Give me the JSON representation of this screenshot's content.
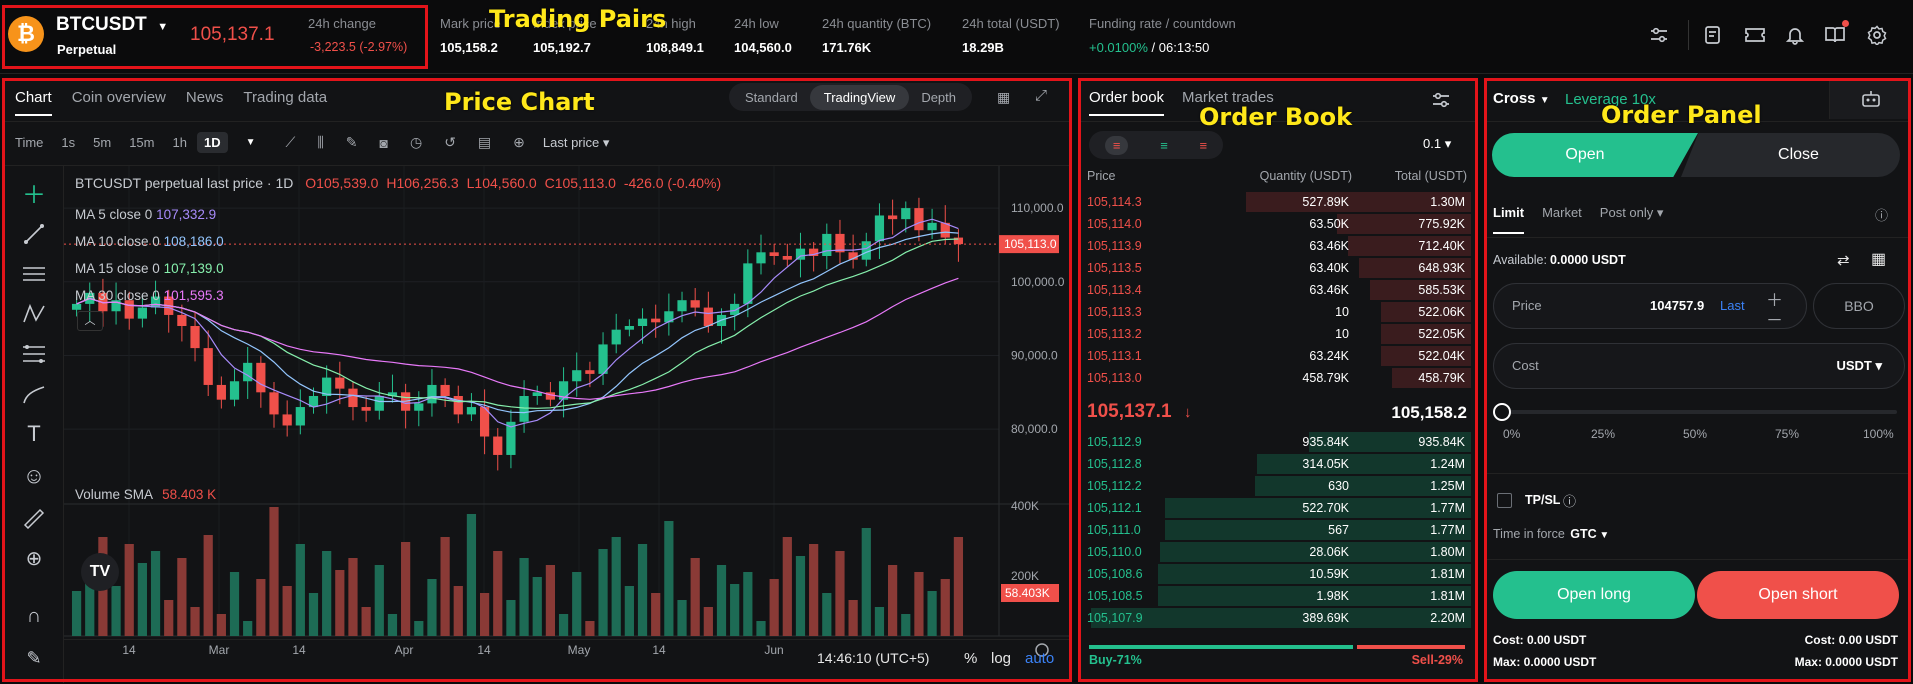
{
  "annotations": {
    "pairs": "Trading Pairs",
    "chart": "Price Chart",
    "orderbook": "Order Book",
    "orderpanel": "Order Panel"
  },
  "ticker": {
    "symbol": "BTCUSDT",
    "type": "Perpetual",
    "last": "105,137.1",
    "change_label": "24h change",
    "change_value": "-3,223.5 (-2.97%)",
    "stats": [
      {
        "label": "Mark price",
        "value": "105,158.2"
      },
      {
        "label": "Index price",
        "value": "105,192.7"
      },
      {
        "label": "24h high",
        "value": "108,849.1"
      },
      {
        "label": "24h low",
        "value": "104,560.0"
      },
      {
        "label": "24h quantity (BTC)",
        "value": "171.76K"
      },
      {
        "label": "24h total (USDT)",
        "value": "18.29B"
      }
    ],
    "funding_label": "Funding rate / countdown",
    "funding_rate": "+0.0100%",
    "countdown": "/ 06:13:50"
  },
  "chart": {
    "tabs": [
      "Chart",
      "Coin overview",
      "News",
      "Trading data"
    ],
    "views": [
      "Standard",
      "TradingView",
      "Depth"
    ],
    "intervals": [
      "Time",
      "1s",
      "5m",
      "15m",
      "1h",
      "1D"
    ],
    "price_type": "Last price",
    "legend_title": "BTCUSDT perpetual last price · 1D",
    "ohlc": {
      "o": "O105,539.0",
      "h": "H106,256.3",
      "l": "L104,560.0",
      "c": "C105,113.0",
      "chg": "-426.0 (-0.40%)"
    },
    "ma": [
      {
        "label": "MA 5 close 0",
        "value": "107,332.9",
        "color": "#a78bfa"
      },
      {
        "label": "MA 10 close 0",
        "value": "108,186.0",
        "color": "#93c5fd"
      },
      {
        "label": "MA 15 close 0",
        "value": "107,139.0",
        "color": "#86efac"
      },
      {
        "label": "MA 30 close 0",
        "value": "101,595.3",
        "color": "#e879f9"
      }
    ],
    "volume_label": "Volume SMA",
    "volume_value": "58.403 K",
    "price_ticks": [
      "110,000.0",
      "100,000.0",
      "90,000.0",
      "80,000.0"
    ],
    "vol_ticks": [
      "400K",
      "200K"
    ],
    "current_price_tag": "105,113.0",
    "vol_tag": "58.403K",
    "x_ticks": [
      "14",
      "Mar",
      "14",
      "Apr",
      "14",
      "May",
      "14",
      "Jun"
    ],
    "clock": "14:46:10 (UTC+5)",
    "pct": "%",
    "log": "log",
    "auto": "auto",
    "tv_logo": "TV"
  },
  "chart_data": {
    "type": "candlestick",
    "x_range": [
      "2025-02-06",
      "2025-05-31"
    ],
    "ylim": [
      75000,
      113000
    ],
    "close_trend": [
      97000,
      98500,
      96000,
      97500,
      95000,
      96500,
      98000,
      95500,
      94000,
      91000,
      86000,
      84000,
      86500,
      89000,
      85000,
      82000,
      80500,
      83000,
      84500,
      87000,
      85500,
      83000,
      82500,
      84500,
      85000,
      82500,
      83500,
      86000,
      84500,
      82000,
      83000,
      79000,
      76500,
      81000,
      84500,
      85000,
      84000,
      86500,
      88000,
      87500,
      91500,
      93500,
      94000,
      95000,
      94500,
      96000,
      97500,
      96500,
      94000,
      95500,
      97000,
      102500,
      104000,
      103500,
      103000,
      104500,
      103500,
      106500,
      104000,
      103000,
      105500,
      109000,
      108500,
      110000,
      107000,
      108000,
      106000,
      105113
    ],
    "volume_range": [
      0,
      450000
    ]
  },
  "orderbook": {
    "tabs": [
      "Order book",
      "Market trades"
    ],
    "precision": "0.1",
    "headers": [
      "Price",
      "Quantity (USDT)",
      "Total (USDT)"
    ],
    "asks": [
      [
        "105,114.3",
        "527.89K",
        "1.30M"
      ],
      [
        "105,114.0",
        "63.50K",
        "775.92K"
      ],
      [
        "105,113.9",
        "63.46K",
        "712.40K"
      ],
      [
        "105,113.5",
        "63.40K",
        "648.93K"
      ],
      [
        "105,113.4",
        "63.46K",
        "585.53K"
      ],
      [
        "105,113.3",
        "10",
        "522.06K"
      ],
      [
        "105,113.2",
        "10",
        "522.05K"
      ],
      [
        "105,113.1",
        "63.24K",
        "522.04K"
      ],
      [
        "105,113.0",
        "458.79K",
        "458.79K"
      ]
    ],
    "last": "105,137.1",
    "mark": "105,158.2",
    "bids": [
      [
        "105,112.9",
        "935.84K",
        "935.84K"
      ],
      [
        "105,112.8",
        "314.05K",
        "1.24M"
      ],
      [
        "105,112.2",
        "630",
        "1.25M"
      ],
      [
        "105,112.1",
        "522.70K",
        "1.77M"
      ],
      [
        "105,111.0",
        "567",
        "1.77M"
      ],
      [
        "105,110.0",
        "28.06K",
        "1.80M"
      ],
      [
        "105,108.6",
        "10.59K",
        "1.81M"
      ],
      [
        "105,108.5",
        "1.98K",
        "1.81M"
      ],
      [
        "105,107.9",
        "389.69K",
        "2.20M"
      ]
    ],
    "buy": "Buy-71%",
    "sell": "Sell-29%",
    "buy_ratio": 71
  },
  "order": {
    "margin": "Cross",
    "leverage": "Leverage 10x",
    "open": "Open",
    "close": "Close",
    "types": [
      "Limit",
      "Market",
      "Post only"
    ],
    "available_label": "Available:",
    "available": "0.0000 USDT",
    "price_label": "Price",
    "price_value": "104757.9",
    "price_last": "Last",
    "bbo": "BBO",
    "cost_label": "Cost",
    "cost_unit": "USDT",
    "slider": [
      "0%",
      "25%",
      "50%",
      "75%",
      "100%"
    ],
    "tpsl": "TP/SL",
    "tif_label": "Time in force",
    "tif": "GTC",
    "open_long": "Open long",
    "open_short": "Open short",
    "cost_left": "Cost: 0.00 USDT",
    "cost_right": "Cost: 0.00 USDT",
    "max_left": "Max: 0.0000 USDT",
    "max_right": "Max: 0.0000 USDT"
  }
}
